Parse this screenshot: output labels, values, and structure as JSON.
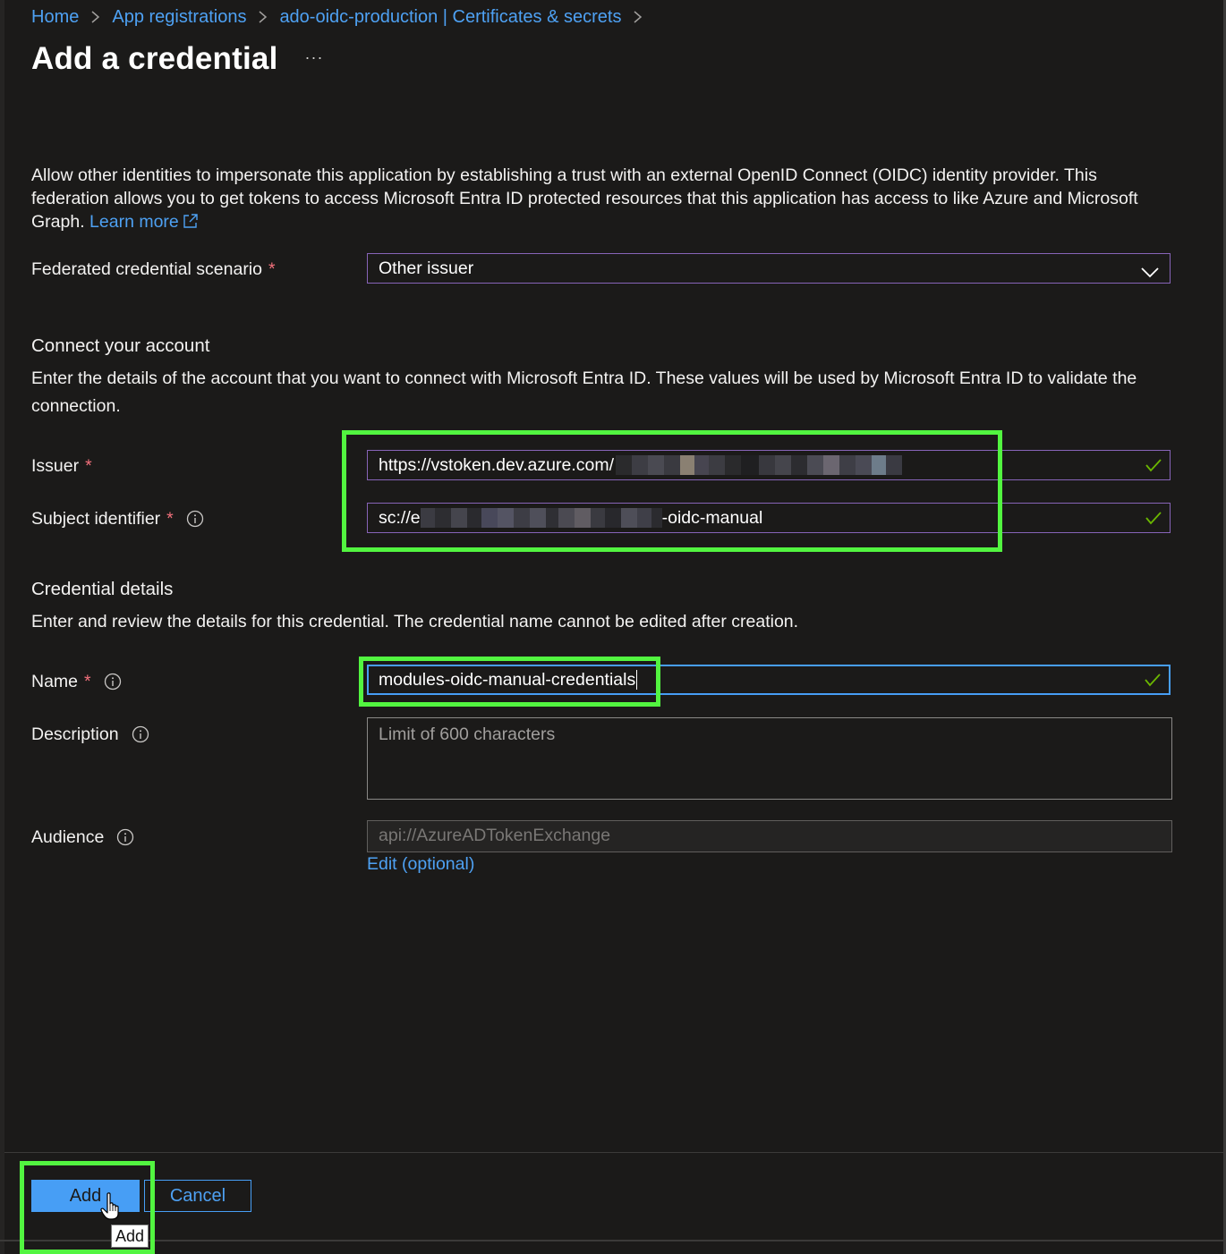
{
  "breadcrumb": {
    "items": [
      "Home",
      "App registrations",
      "ado-oidc-production | Certificates & secrets"
    ]
  },
  "page": {
    "title": "Add a credential",
    "more_label": "···"
  },
  "intro": {
    "text": "Allow other identities to impersonate this application by establishing a trust with an external OpenID Connect (OIDC) identity provider. This federation allows you to get tokens to access Microsoft Entra ID protected resources that this application has access to like Azure and Microsoft Graph.",
    "learn_more": "Learn more"
  },
  "scenario": {
    "label": "Federated credential scenario",
    "required": "*",
    "value": "Other issuer"
  },
  "connect": {
    "heading": "Connect your account",
    "text": "Enter the details of the account that you want to connect with Microsoft Entra ID. These values will be used by Microsoft Entra ID to validate the connection.",
    "issuer": {
      "label": "Issuer",
      "required": "*",
      "value_prefix": "https://vstoken.dev.azure.com/"
    },
    "subject": {
      "label": "Subject identifier",
      "required": "*",
      "value_prefix": "sc://e",
      "value_suffix": "-oidc-manual"
    }
  },
  "details": {
    "heading": "Credential details",
    "text": "Enter and review the details for this credential. The credential name cannot be edited after creation.",
    "name": {
      "label": "Name",
      "required": "*",
      "value": "modules-oidc-manual-credentials"
    },
    "description": {
      "label": "Description",
      "placeholder": "Limit of 600 characters"
    },
    "audience": {
      "label": "Audience",
      "value": "api://AzureADTokenExchange",
      "edit_label": "Edit (optional)"
    }
  },
  "footer": {
    "add_label": "Add",
    "cancel_label": "Cancel",
    "tooltip": "Add"
  },
  "colors": {
    "accent": "#479ef5",
    "link": "#4ea1f3",
    "highlight": "#52f540",
    "valid": "#6bb700",
    "required": "#f1707b"
  },
  "icons": [
    "chevron-right-icon",
    "external-link-icon",
    "chevron-down-icon",
    "checkmark-icon",
    "info-icon",
    "hand-cursor-icon"
  ]
}
